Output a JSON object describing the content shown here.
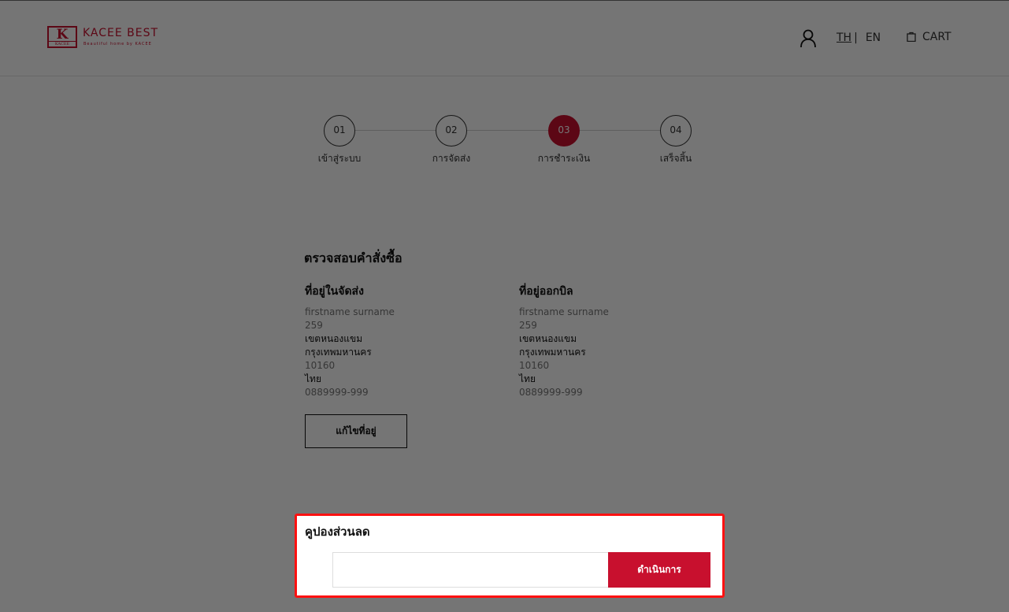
{
  "header": {
    "logo_mark": "K",
    "logo_mark_sub": "KACEE",
    "brand_name": "KACEE BEST",
    "brand_tagline": "Beautiful home by KACEE",
    "lang_th": "TH",
    "lang_separator": "|",
    "lang_en": "EN",
    "cart_label": "CART"
  },
  "stepper": {
    "steps": [
      {
        "number": "01",
        "label": "เข้าสู่ระบบ"
      },
      {
        "number": "02",
        "label": "การจัดส่ง"
      },
      {
        "number": "03",
        "label": "การชำระเงิน"
      },
      {
        "number": "04",
        "label": "เสร็จสิ้น"
      }
    ],
    "active_step": 3
  },
  "review": {
    "title": "ตรวจสอบคำสั่งซื้อ",
    "shipping": {
      "heading": "ที่อยู่ในจัดส่ง",
      "name": "firstname surname",
      "house_no": "259",
      "district": "เขตหนองแขม",
      "province": "กรุงเทพมหานคร",
      "postcode": "10160",
      "country": "ไทย",
      "phone": "0889999-999"
    },
    "billing": {
      "heading": "ที่อยู่ออกบิล",
      "name": "firstname surname",
      "house_no": "259",
      "district": "เขตหนองแขม",
      "province": "กรุงเทพมหานคร",
      "postcode": "10160",
      "country": "ไทย",
      "phone": "0889999-999"
    },
    "edit_address_label": "แก้ไขที่อยู่"
  },
  "coupon": {
    "title": "คูปองส่วนลด",
    "input_value": "",
    "input_placeholder": "",
    "submit_label": "ดำเนินการ"
  },
  "colors": {
    "accent": "#c8102e",
    "highlight_border": "#ff1111",
    "overlay": "rgba(0,0,0,0.54)"
  }
}
